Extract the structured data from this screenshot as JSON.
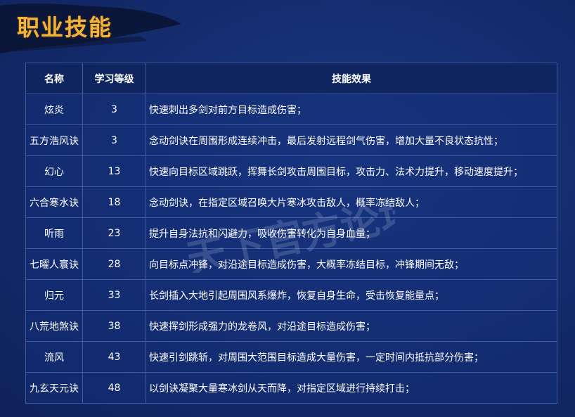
{
  "page": {
    "title": "职业技能"
  },
  "table": {
    "headers": {
      "name": "名称",
      "level": "学习等级",
      "effect": "技能效果"
    },
    "rows": [
      {
        "name": "炫炎",
        "level": "3",
        "effect": "快速刺出多剑对前方目标造成伤害；"
      },
      {
        "name": "五方浩风诀",
        "level": "3",
        "effect": "念动剑诀在周围形成连续冲击，最后发射远程剑气伤害，增加大量不良状态抗性；"
      },
      {
        "name": "幻心",
        "level": "13",
        "effect": "快速向目标区域跳跃，挥舞长剑攻击周围目标，攻击力、法术力提升，移动速度提升；"
      },
      {
        "name": "六合寒水诀",
        "level": "18",
        "effect": "念动剑诀，在指定区域召唤大片寒冰攻击敌人，概率冻结敌人；"
      },
      {
        "name": "听雨",
        "level": "23",
        "effect": "提升自身法抗和闪避力，吸收伤害转化为自身血量；"
      },
      {
        "name": "七曜人寰诀",
        "level": "28",
        "effect": "向目标点冲锋，对沿途目标造成伤害，大概率冻结目标，冲锋期间无敌；"
      },
      {
        "name": "归元",
        "level": "33",
        "effect": "长剑插入大地引起周围风系爆炸，恢复自身生命，受击恢复能量点；"
      },
      {
        "name": "八荒地煞诀",
        "level": "38",
        "effect": "快速挥剑形成强力的龙卷风，对沿途目标造成伤害；"
      },
      {
        "name": "流风",
        "level": "43",
        "effect": "快速引剑跳斩，对周围大范围目标造成大量伤害，一定时间内抵抗部分伤害；"
      },
      {
        "name": "九玄天元诀",
        "level": "48",
        "effect": "以剑诀凝聚大量寒冰剑从天而降，对指定区域进行持续打击；"
      }
    ]
  },
  "watermark": {
    "text": "天下官方论坛"
  },
  "colors": {
    "title": "#f3b33b",
    "background": "#13296a",
    "header_bg": "#0e2560",
    "border": "#3d5aa3"
  }
}
